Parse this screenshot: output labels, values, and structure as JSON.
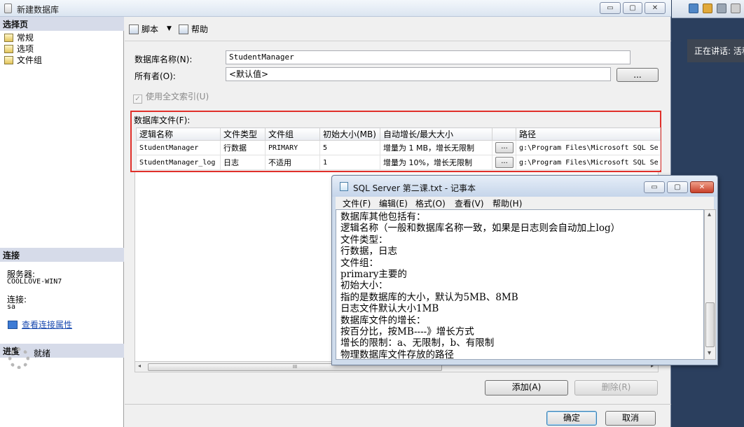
{
  "dialog": {
    "title": "新建数据库",
    "minimize": "▭",
    "maximize": "▢",
    "close": "✕"
  },
  "left": {
    "select_page_header": "选择页",
    "nav_items": [
      "常规",
      "选项",
      "文件组"
    ],
    "connection_header": "连接",
    "server_label": "服务器:",
    "server_value": "COOLLOVE-WIN7",
    "connection_label": "连接:",
    "connection_value": "sa",
    "view_props_link": "查看连接属性",
    "progress_header": "进度",
    "progress_status": "就绪"
  },
  "toolbar": {
    "script_label": "脚本",
    "script_dropdown": "▼",
    "help_label": "帮助"
  },
  "form": {
    "db_name_label": "数据库名称(N):",
    "db_name_value": "StudentManager",
    "owner_label": "所有者(O):",
    "owner_value": "<默认值>",
    "owner_browse": "...",
    "fulltext_label": "使用全文索引(U)",
    "fulltext_check": "✓"
  },
  "files": {
    "title": "数据库文件(F):",
    "columns": [
      "逻辑名称",
      "文件类型",
      "文件组",
      "初始大小(MB)",
      "自动增长/最大大小",
      "",
      "路径"
    ],
    "rows": [
      {
        "name": "StudentManager",
        "type": "行数据",
        "group": "PRIMARY",
        "size": "5",
        "growth": "增量为 1 MB，增长无限制",
        "btn": "...",
        "path": "g:\\Program Files\\Microsoft SQL Se"
      },
      {
        "name": "StudentManager_log",
        "type": "日志",
        "group": "不适用",
        "size": "1",
        "growth": "增量为 10%，增长无限制",
        "btn": "...",
        "path": "g:\\Program Files\\Microsoft SQL Se"
      }
    ],
    "scroll_left": "◂",
    "scroll_right": "▸",
    "scroll_grip": "III"
  },
  "buttons": {
    "add": "添加(A)",
    "remove": "删除(R)",
    "ok": "确定",
    "cancel": "取消"
  },
  "notepad": {
    "title": "SQL Server 第二课.txt - 记事本",
    "menus": [
      "文件(F)",
      "编辑(E)",
      "格式(O)",
      "查看(V)",
      "帮助(H)"
    ],
    "text": "数据库其他包括有：\n逻辑名称（一般和数据库名称一致，如果是日志则会自动加上log）\n文件类型：\n行数据，日志\n文件组：\nprimary主要的\n初始大小：\n指的是数据库的大小，默认为5MB、8MB\n日志文件默认大小1MB\n数据库文件的增长：\n按百分比，按MB----》增长方式\n增长的限制：a、无限制，b、有限制\n物理数据库文件存放的路径",
    "scroll_up": "▴",
    "scroll_down": "▾"
  },
  "background": {
    "speaking_text": "正在讲话: 活和"
  }
}
